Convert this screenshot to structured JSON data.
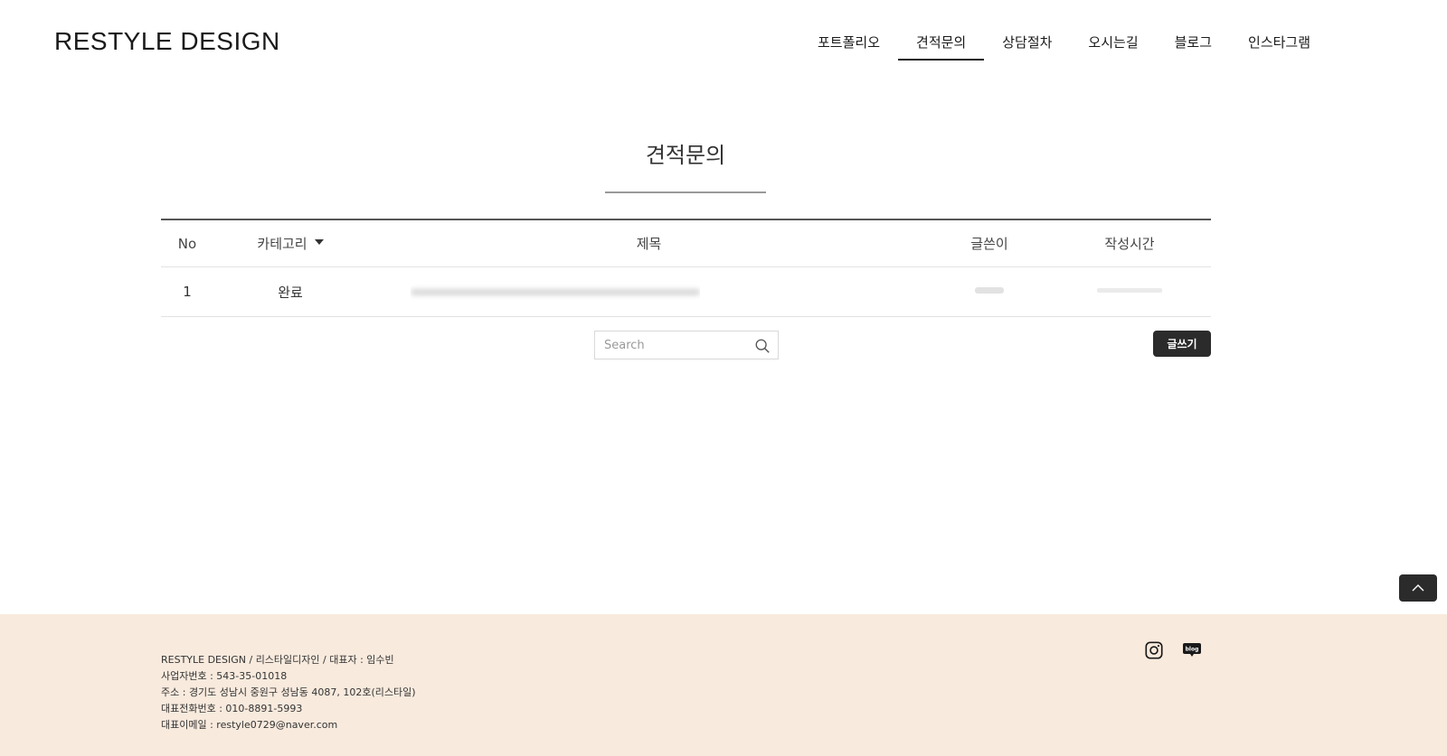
{
  "header": {
    "logo": "RESTYLE DESIGN",
    "nav": [
      "포트폴리오",
      "견적문의",
      "상담절차",
      "오시는길",
      "블로그",
      "인스타그램"
    ],
    "active_nav": "견적문의"
  },
  "page": {
    "title": "견적문의"
  },
  "board": {
    "columns": {
      "no": "No",
      "category": "카테고리",
      "title": "제목",
      "writer": "글쓴이",
      "time": "작성시간"
    },
    "rows": [
      {
        "no": "1",
        "category": "완료",
        "title": "",
        "writer": "",
        "time": ""
      }
    ]
  },
  "search": {
    "placeholder": "Search",
    "value": ""
  },
  "write_button": "글쓰기",
  "footer": {
    "lines": [
      "RESTYLE DESIGN / 리스타일디자인 / 대표자 : 임수빈",
      "사업자번호 : 543-35-01018",
      "주소 : 경기도 성남시 중원구 성남동 4087, 102호(리스타일)",
      "대표전화번호 : 010-8891-5993",
      "대표이메일 : restyle0729@naver.com"
    ],
    "social_icons": [
      "instagram-icon",
      "blog-icon"
    ],
    "blog_icon_text": "blog"
  },
  "colors": {
    "footer_bg": "#f8eadd",
    "button_dark": "#2b2b2b"
  }
}
